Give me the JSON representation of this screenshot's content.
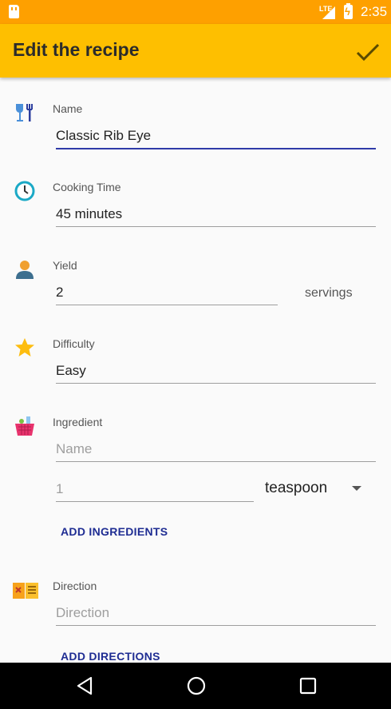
{
  "status_bar": {
    "time": "2:35",
    "network": "LTE"
  },
  "app_bar": {
    "title": "Edit the recipe",
    "confirm_icon": "check-icon"
  },
  "form": {
    "name": {
      "label": "Name",
      "value": "Classic Rib Eye",
      "icon": "dining-icon"
    },
    "cooking_time": {
      "label": "Cooking Time",
      "value": "45 minutes",
      "icon": "clock-icon"
    },
    "yield": {
      "label": "Yield",
      "value": "2",
      "suffix": "servings",
      "icon": "person-icon"
    },
    "difficulty": {
      "label": "Difficulty",
      "value": "Easy",
      "icon": "star-icon"
    },
    "ingredient": {
      "label": "Ingredient",
      "icon": "basket-icon",
      "name_placeholder": "Name",
      "quantity_placeholder": "1",
      "unit": "teaspoon",
      "add_button": "ADD INGREDIENTS"
    },
    "direction": {
      "label": "Direction",
      "icon": "recipe-book-icon",
      "placeholder": "Direction",
      "add_button": "ADD DIRECTIONS"
    }
  },
  "colors": {
    "status_bar": "#fea000",
    "app_bar": "#febf00",
    "accent": "#2f3ba8",
    "button_text": "#1f2d93"
  }
}
